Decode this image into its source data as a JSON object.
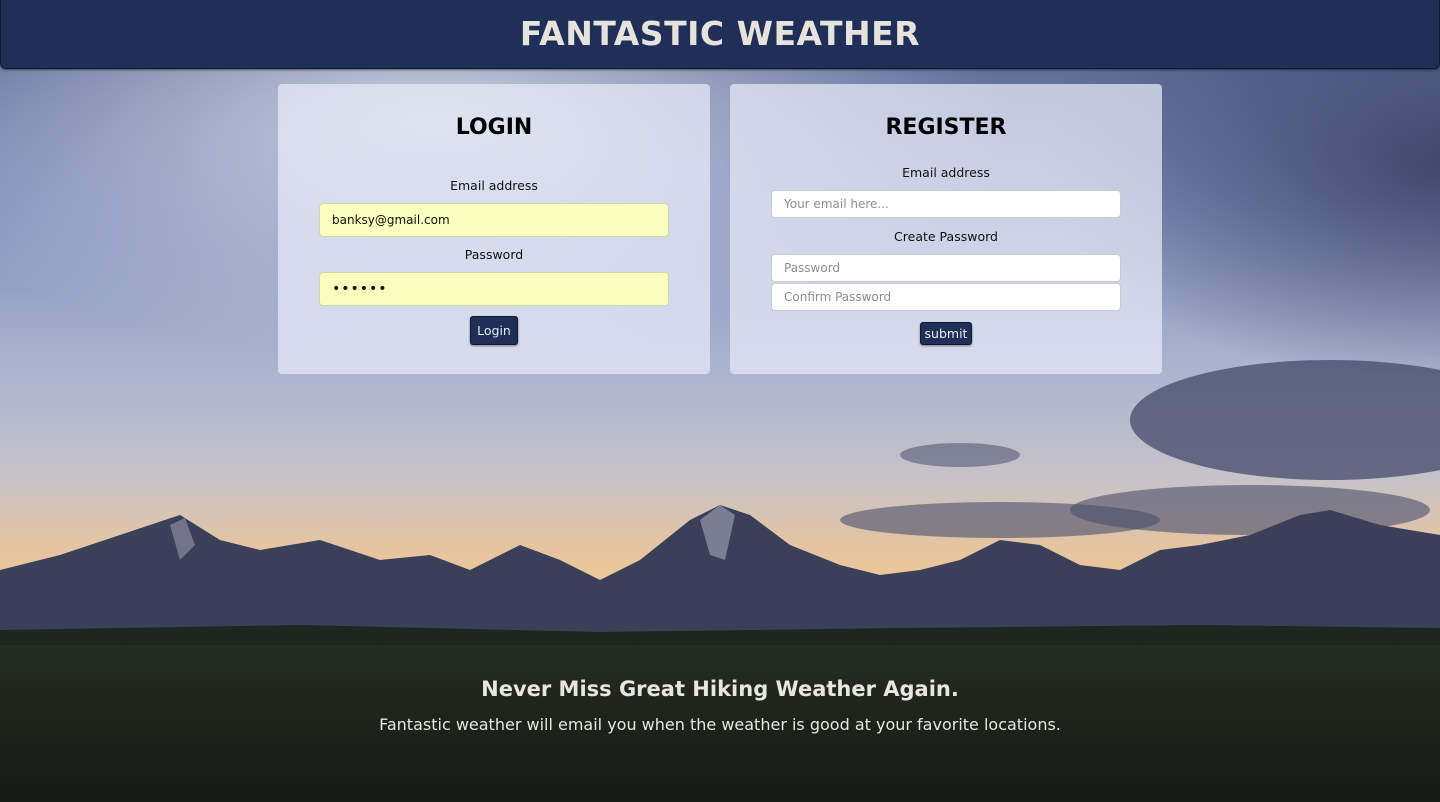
{
  "header": {
    "title": "FANTASTIC WEATHER"
  },
  "login": {
    "heading": "LOGIN",
    "email_label": "Email address",
    "email_value": "banksy@gmail.com",
    "password_label": "Password",
    "password_value": "••••••",
    "button_label": "Login"
  },
  "register": {
    "heading": "REGISTER",
    "email_label": "Email address",
    "email_placeholder": "Your email here...",
    "password_label": "Create Password",
    "password_placeholder": "Password",
    "confirm_placeholder": "Confirm Password",
    "button_label": "submit"
  },
  "footer": {
    "headline": "Never Miss Great Hiking Weather Again.",
    "subtext": "Fantastic weather will email you when the weather is good at your favorite locations."
  },
  "colors": {
    "header_bg": "#1f2f58",
    "button_bg": "#1f2f58",
    "autofill_bg": "#fbffbd",
    "header_text": "#e6e3dc"
  }
}
